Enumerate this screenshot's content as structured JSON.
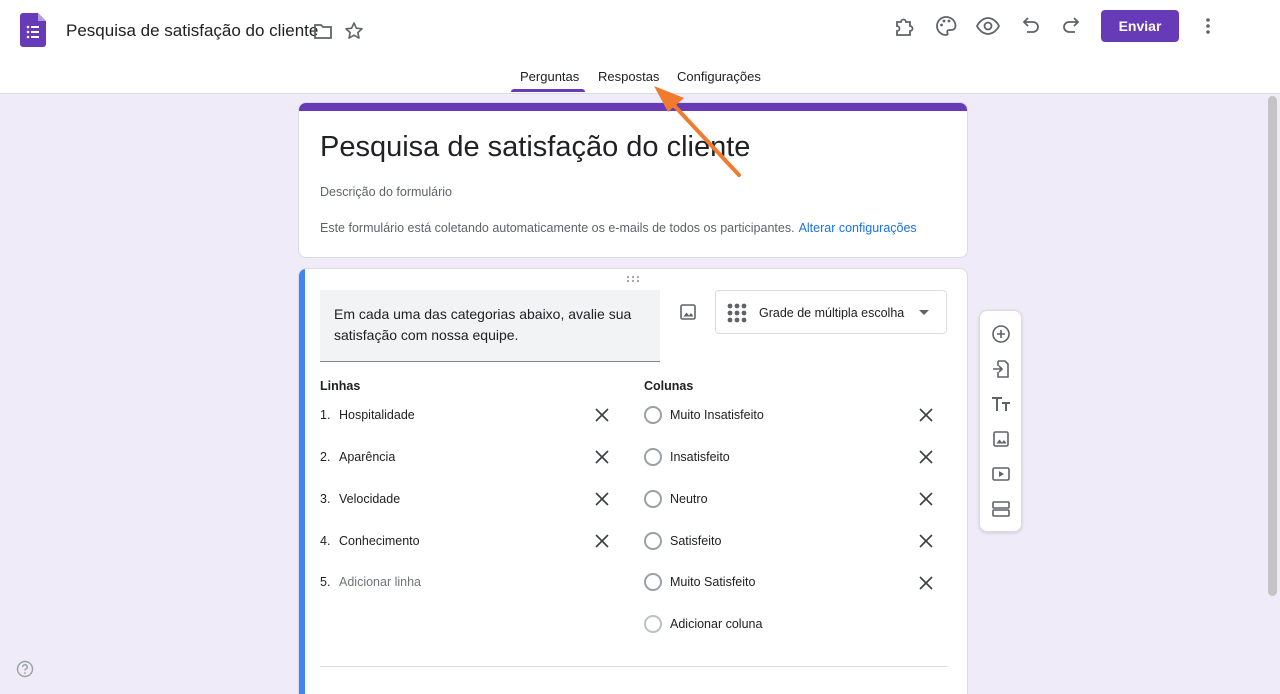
{
  "header": {
    "title": "Pesquisa de satisfação do cliente",
    "send_label": "Enviar",
    "icons": [
      "forms-logo-icon",
      "folder-icon",
      "star-icon",
      "addon-puzzle-icon",
      "palette-icon",
      "preview-eye-icon",
      "undo-icon",
      "redo-icon",
      "more-vert-icon"
    ]
  },
  "tabs": [
    {
      "label": "Perguntas",
      "active": true
    },
    {
      "label": "Respostas",
      "active": false
    },
    {
      "label": "Configurações",
      "active": false
    }
  ],
  "form": {
    "title": "Pesquisa de satisfação do cliente",
    "description_placeholder": "Descrição do formulário",
    "email_note": "Este formulário está coletando automaticamente os e-mails de todos os participantes.",
    "email_link": "Alterar configurações"
  },
  "question": {
    "text": "Em cada uma das categorias abaixo, avalie sua satisfação com nossa equipe.",
    "type": "Grade de múltipla escolha",
    "rows_heading": "Linhas",
    "columns_heading": "Colunas",
    "rows": [
      {
        "num": "1.",
        "label": "Hospitalidade"
      },
      {
        "num": "2.",
        "label": "Aparência"
      },
      {
        "num": "3.",
        "label": "Velocidade"
      },
      {
        "num": "4.",
        "label": "Conhecimento"
      }
    ],
    "add_row": {
      "num": "5.",
      "label": "Adicionar linha"
    },
    "columns": [
      "Muito Insatisfeito",
      "Insatisfeito",
      "Neutro",
      "Satisfeito",
      "Muito Satisfeito"
    ],
    "add_column": "Adicionar coluna"
  },
  "toolbar": [
    "add-question-icon",
    "import-questions-icon",
    "add-title-icon",
    "add-image-icon",
    "add-video-icon",
    "add-section-icon"
  ],
  "colors": {
    "accent": "#673ab7",
    "background": "#f0ebf8",
    "question_bar": "#4285f4",
    "annotation_arrow": "#f07a2e",
    "link": "#1a73e8"
  }
}
